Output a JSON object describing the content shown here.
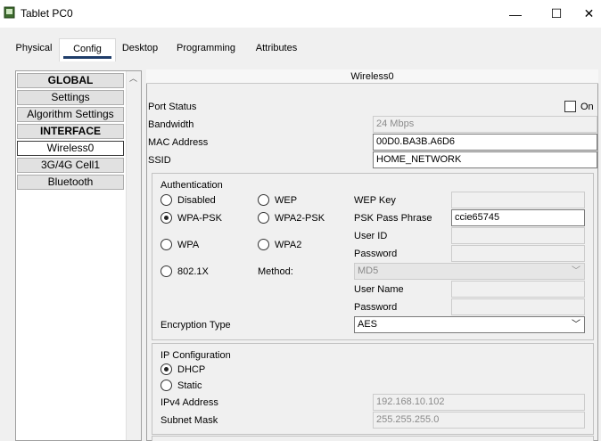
{
  "window": {
    "title": "Tablet PC0",
    "minimize": "—",
    "maximize": "☐",
    "close": "✕"
  },
  "tabs": [
    {
      "label": "Physical"
    },
    {
      "label": "Config"
    },
    {
      "label": "Desktop"
    },
    {
      "label": "Programming"
    },
    {
      "label": "Attributes"
    }
  ],
  "sidebar": {
    "items": [
      {
        "label": "GLOBAL"
      },
      {
        "label": "Settings"
      },
      {
        "label": "Algorithm Settings"
      },
      {
        "label": "INTERFACE"
      },
      {
        "label": "Wireless0"
      },
      {
        "label": "3G/4G Cell1"
      },
      {
        "label": "Bluetooth"
      }
    ]
  },
  "panel": {
    "title": "Wireless0",
    "port_status_label": "Port Status",
    "port_on_label": "On",
    "bandwidth_label": "Bandwidth",
    "bandwidth_value": "24 Mbps",
    "mac_label": "MAC Address",
    "mac_value": "00D0.BA3B.A6D6",
    "ssid_label": "SSID",
    "ssid_value": "HOME_NETWORK"
  },
  "auth": {
    "title": "Authentication",
    "disabled": "Disabled",
    "wep": "WEP",
    "wpa_psk": "WPA-PSK",
    "wpa2_psk": "WPA2-PSK",
    "wpa": "WPA",
    "wpa2": "WPA2",
    "dot1x": "802.1X",
    "method_label": "Method:",
    "wep_key_label": "WEP Key",
    "psk_label": "PSK Pass Phrase",
    "psk_value": "ccie65745",
    "user_id_label": "User ID",
    "password_label": "Password",
    "method_value": "MD5",
    "user_name_label": "User Name",
    "password2_label": "Password",
    "encryption_label": "Encryption Type",
    "encryption_value": "AES"
  },
  "ip": {
    "title": "IP Configuration",
    "dhcp": "DHCP",
    "static": "Static",
    "ipv4_label": "IPv4 Address",
    "ipv4_value": "192.168.10.102",
    "mask_label": "Subnet Mask",
    "mask_value": "255.255.255.0"
  }
}
